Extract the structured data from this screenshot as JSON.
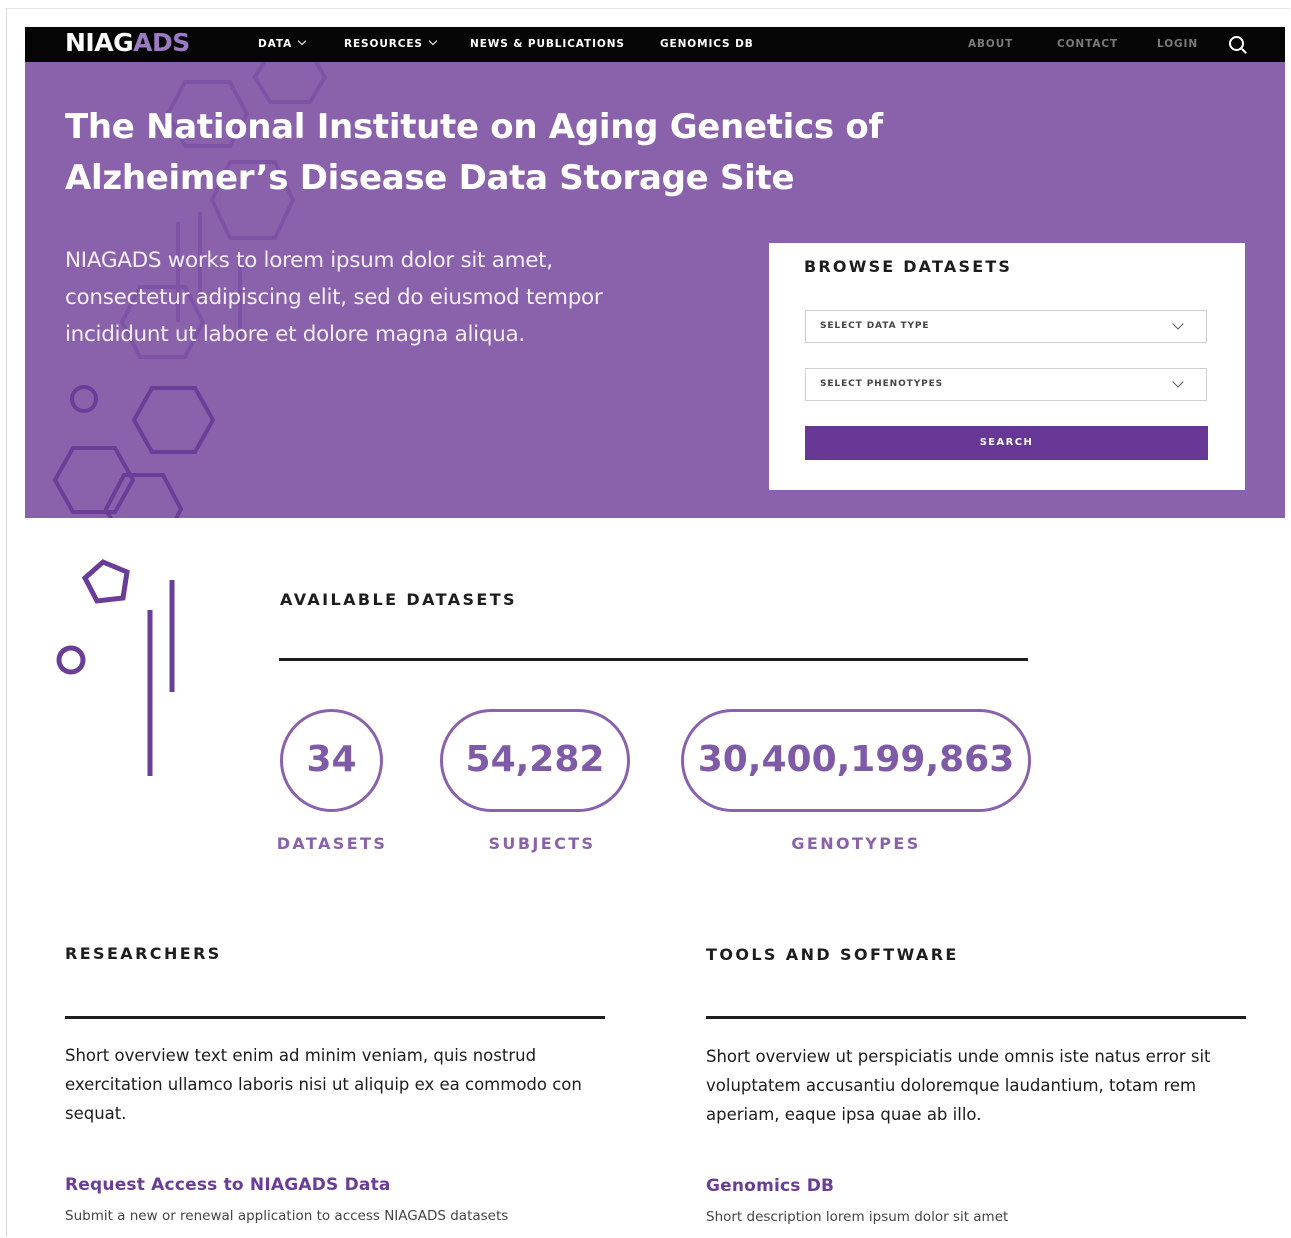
{
  "nav": {
    "logo_part1": "NIAG",
    "logo_part2": "ADS",
    "items": [
      {
        "label": "DATA"
      },
      {
        "label": "RESOURCES"
      },
      {
        "label": "NEWS & PUBLICATIONS"
      },
      {
        "label": "GENOMICS DB"
      }
    ],
    "right_items": [
      {
        "label": "ABOUT"
      },
      {
        "label": "CONTACT"
      },
      {
        "label": "LOGIN"
      }
    ]
  },
  "hero": {
    "title_line1": "The National Institute on Aging Genetics of",
    "title_line2": "Alzheimer’s Disease Data Storage Site",
    "intro": "NIAGADS works to lorem ipsum dolor sit amet, consectetur adipiscing elit, sed do eiusmod tempor incididunt ut labore et dolore magna aliqua."
  },
  "browse": {
    "title": "BROWSE DATASETS",
    "select_data_type": "SELECT DATA TYPE",
    "select_phenotypes": "SELECT PHENOTYPES",
    "search_label": "SEARCH"
  },
  "available": {
    "title": "AVAILABLE DATASETS",
    "stats": [
      {
        "value": "34",
        "label": "DATASETS"
      },
      {
        "value": "54,282",
        "label": "SUBJECTS"
      },
      {
        "value": "30,400,199,863",
        "label": "GENOTYPES"
      }
    ]
  },
  "researchers": {
    "title": "RESEARCHERS",
    "text": "Short overview text enim ad minim veniam, quis nostrud exercitation ullamco laboris nisi ut aliquip ex ea commodo con sequat.",
    "link_title": "Request Access to NIAGADS Data",
    "link_desc": "Submit a new or renewal application to access NIAGADS datasets"
  },
  "tools": {
    "title": "TOOLS AND SOFTWARE",
    "text": "Short overview ut perspiciatis unde omnis iste natus error sit voluptatem accusantiu doloremque laudantium, totam rem aperiam, eaque ipsa quae ab illo.",
    "link_title": "Genomics DB",
    "link_desc": "Short description lorem ipsum dolor sit amet"
  },
  "colors": {
    "purple": "#8a62ab",
    "dark_purple": "#663794",
    "nav_bg": "#050505"
  }
}
